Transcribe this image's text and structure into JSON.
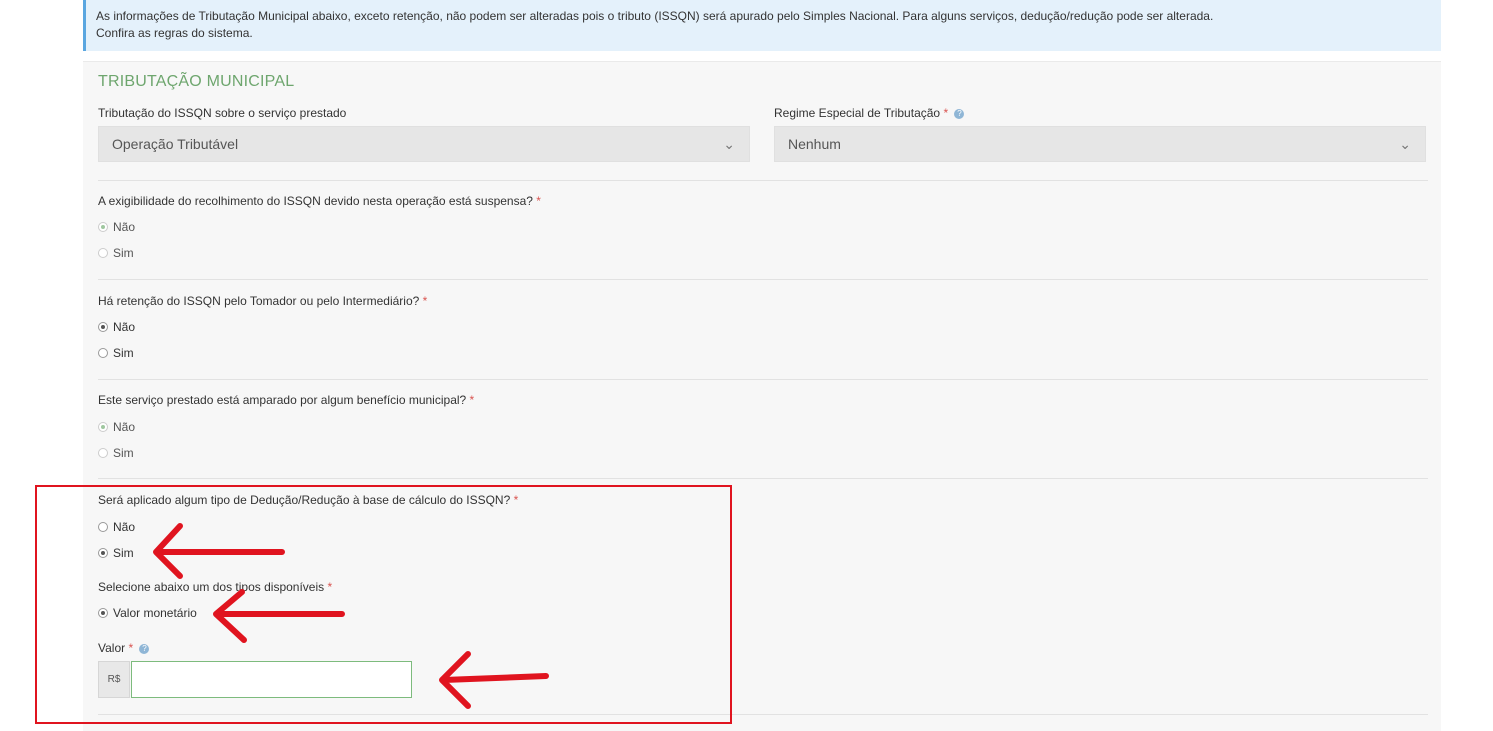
{
  "info": {
    "line1": "As informações de Tributação Municipal abaixo, exceto retenção, não podem ser alteradas pois o tributo (ISSQN) será apurado pelo Simples Nacional. Para alguns serviços, dedução/redução pode ser alterada.",
    "line2": "Confira as regras do sistema."
  },
  "section": {
    "title": "TRIBUTAÇÃO MUNICIPAL"
  },
  "tributacao": {
    "label": "Tributação do ISSQN sobre o serviço prestado",
    "value": "Operação Tributável"
  },
  "regime": {
    "label": "Regime Especial de Tributação",
    "value": "Nenhum"
  },
  "required_mark": "*",
  "help_glyph": "?",
  "questions": [
    {
      "text": "A exigibilidade do recolhimento do ISSQN devido nesta operação está suspensa?",
      "options": [
        "Não",
        "Sim"
      ],
      "selected": "Não",
      "disabled": true
    },
    {
      "text": "Há retenção do ISSQN pelo Tomador ou pelo Intermediário?",
      "options": [
        "Não",
        "Sim"
      ],
      "selected": "Não",
      "disabled": false
    },
    {
      "text": "Este serviço prestado está amparado por algum benefício municipal?",
      "options": [
        "Não",
        "Sim"
      ],
      "selected": "Não",
      "disabled": true
    },
    {
      "text": "Será aplicado algum tipo de Dedução/Redução à base de cálculo do ISSQN?",
      "options": [
        "Não",
        "Sim"
      ],
      "selected": "Sim",
      "disabled": false
    }
  ],
  "deducao_tipo": {
    "label": "Selecione abaixo um dos tipos disponíveis",
    "option": "Valor monetário",
    "selected": true
  },
  "valor": {
    "label": "Valor",
    "prefix": "R$",
    "value": ""
  },
  "annotation_color": "#e0141f"
}
